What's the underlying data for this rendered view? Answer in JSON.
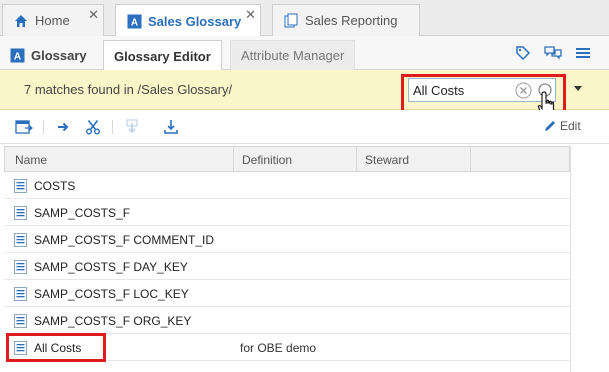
{
  "top_tabs": [
    {
      "label": "Home",
      "icon": "home-icon"
    },
    {
      "label": "Sales Glossary",
      "icon": "glossary-icon"
    },
    {
      "label": "Sales Reporting",
      "icon": "document-icon"
    }
  ],
  "sub_tabs": [
    {
      "label": "Glossary"
    },
    {
      "label": "Glossary Editor"
    },
    {
      "label": "Attribute Manager"
    }
  ],
  "search": {
    "status": "7 matches found in /Sales Glossary/",
    "value": "All Costs"
  },
  "toolbar": {
    "edit_label": "Edit"
  },
  "table": {
    "columns": [
      "Name",
      "Definition",
      "Steward"
    ],
    "rows": [
      {
        "name": "COSTS",
        "definition": ""
      },
      {
        "name": "SAMP_COSTS_F",
        "definition": ""
      },
      {
        "name": "SAMP_COSTS_F COMMENT_ID",
        "definition": ""
      },
      {
        "name": "SAMP_COSTS_F DAY_KEY",
        "definition": ""
      },
      {
        "name": "SAMP_COSTS_F LOC_KEY",
        "definition": ""
      },
      {
        "name": "SAMP_COSTS_F ORG_KEY",
        "definition": ""
      },
      {
        "name": "All Costs",
        "definition": "for OBE demo"
      }
    ]
  },
  "colors": {
    "accent": "#2a6fbd",
    "highlight": "#e01b1b",
    "search_bar_bg": "#fbf6c9"
  }
}
